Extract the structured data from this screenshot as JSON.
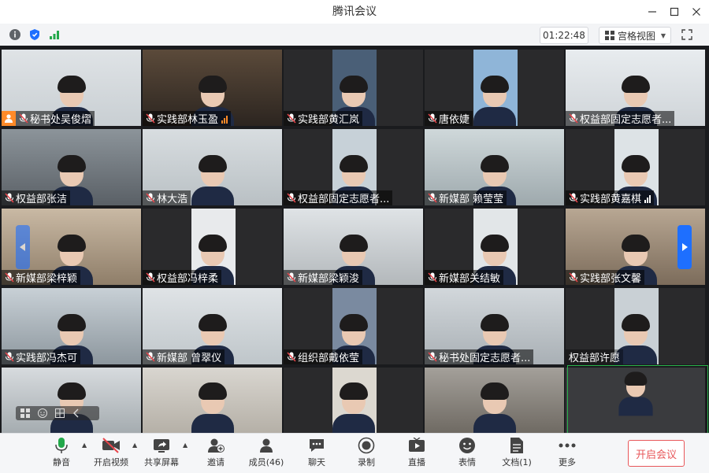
{
  "app": {
    "title": "腾讯会议"
  },
  "topbar": {
    "timer": "01:22:48",
    "view_label": "宫格视图"
  },
  "participants": [
    "秘书处吴俊熠",
    "实践部林玉盈",
    "实践部黄汇岚",
    "唐依婕",
    "权益部固定志愿者...",
    "权益部张洁",
    "林大浩",
    "权益部固定志愿者...",
    "新媒部 赖莹莹",
    "实践部黄嘉棋",
    "新媒部梁梓颖",
    "权益部冯梓柔",
    "新媒部梁颖浚",
    "新媒部关结敏",
    "实践部张文馨",
    "实践部冯杰可",
    "新媒部 曾翠仪",
    "组织部戴依莹",
    "秘书处固定志愿者...",
    "权益部许愿"
  ],
  "toolbar": {
    "mute": "静音",
    "video": "开启视频",
    "share": "共享屏幕",
    "invite": "邀请",
    "members": "成员(46)",
    "chat": "聊天",
    "record": "录制",
    "live": "直播",
    "emoji": "表情",
    "docs": "文档(1)",
    "more": "更多",
    "leave": "开启会议"
  },
  "colors": {
    "accent": "#1e6fff",
    "leave": "#e8575a",
    "host_badge": "#ff8a28",
    "active_speaker": "#29b34a"
  }
}
